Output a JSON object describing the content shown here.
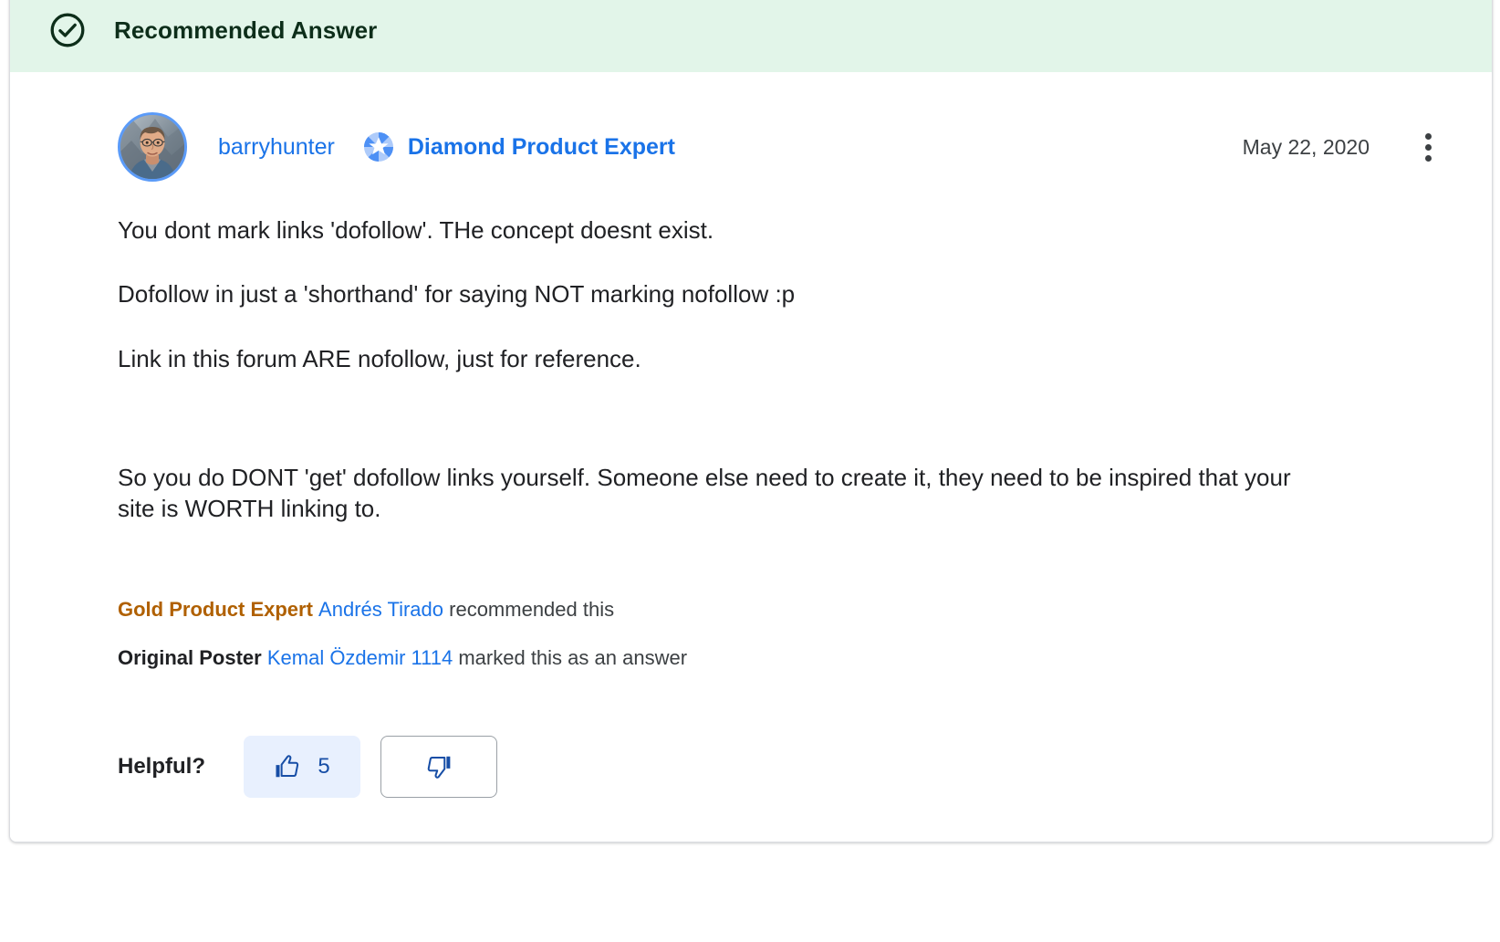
{
  "banner": {
    "label": "Recommended Answer",
    "icon": "check-circle-icon",
    "bg_color": "#e2f5e9",
    "text_color": "#0d2e1a"
  },
  "author": {
    "avatar_alt": "barryhunter avatar",
    "name": "barryhunter",
    "badge_icon": "diamond-expert-badge-icon",
    "expert_title": "Diamond Product Expert",
    "date": "May 22, 2020",
    "more_menu_icon": "more-vert-icon",
    "link_color": "#1a73e8"
  },
  "message": {
    "paragraphs": [
      "You dont mark links 'dofollow'. THe concept doesnt exist.",
      "Dofollow in just a 'shorthand' for saying NOT marking nofollow :p",
      "Link in this forum ARE nofollow, just for reference.",
      "",
      "So you do DONT 'get' dofollow links yourself. Someone else need to create it, they need to be inspired that your site is WORTH linking to."
    ]
  },
  "attributions": {
    "recommendation": {
      "badge": "Gold Product Expert",
      "badge_color": "#b06000",
      "user": "Andrés Tirado",
      "tail": " recommended this"
    },
    "marked_answer": {
      "badge": "Original Poster",
      "user": "Kemal Özdemir 1114",
      "tail": " marked this as an answer"
    }
  },
  "helpful": {
    "label": "Helpful?",
    "upvote": {
      "icon": "thumb-up-icon",
      "count": "5",
      "bg_color": "#e8f0fe",
      "icon_color": "#174ea6"
    },
    "downvote": {
      "icon": "thumb-down-icon",
      "icon_color": "#174ea6",
      "border_color": "#9aa0a6"
    }
  }
}
